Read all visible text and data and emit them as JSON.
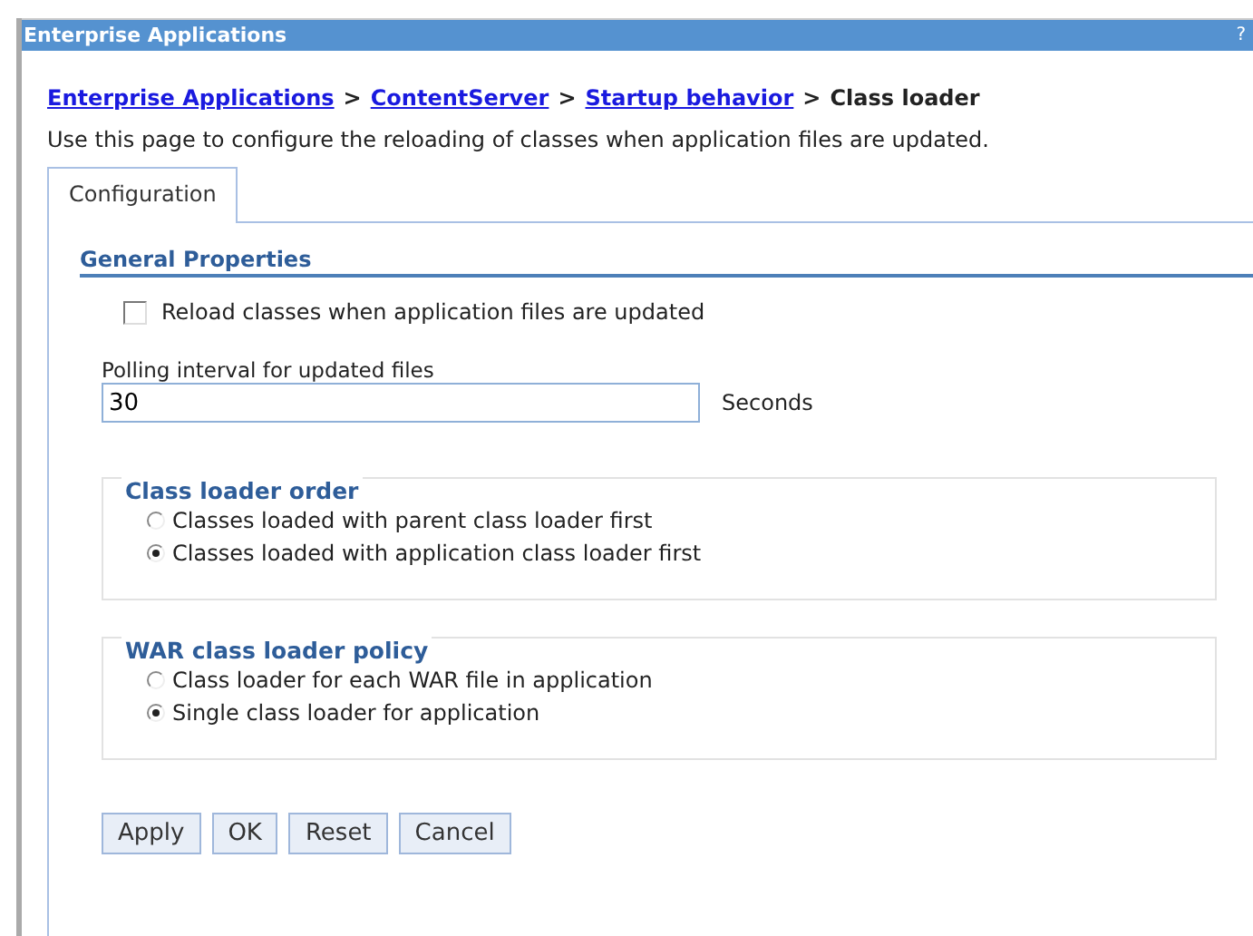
{
  "window": {
    "title": "Enterprise Applications",
    "help": "?"
  },
  "breadcrumb": {
    "links": [
      "Enterprise Applications",
      "ContentServer",
      "Startup behavior"
    ],
    "separator": ">",
    "current": "Class loader"
  },
  "description": "Use this page to configure the reloading of classes when application files are updated.",
  "tabs": [
    {
      "label": "Configuration",
      "selected": true
    }
  ],
  "section": "General Properties",
  "reload": {
    "label": "Reload classes when application files are updated",
    "checked": false
  },
  "polling": {
    "label": "Polling interval for updated files",
    "value": "30",
    "unit": "Seconds"
  },
  "groups": [
    {
      "legend": "Class loader order",
      "options": [
        {
          "label": "Classes loaded with parent class loader first",
          "selected": false
        },
        {
          "label": "Classes loaded with application class loader first",
          "selected": true
        }
      ]
    },
    {
      "legend": "WAR class loader policy",
      "options": [
        {
          "label": "Class loader for each WAR file in application",
          "selected": false
        },
        {
          "label": "Single class loader for application",
          "selected": true
        }
      ]
    }
  ],
  "buttons": [
    "Apply",
    "OK",
    "Reset",
    "Cancel"
  ]
}
